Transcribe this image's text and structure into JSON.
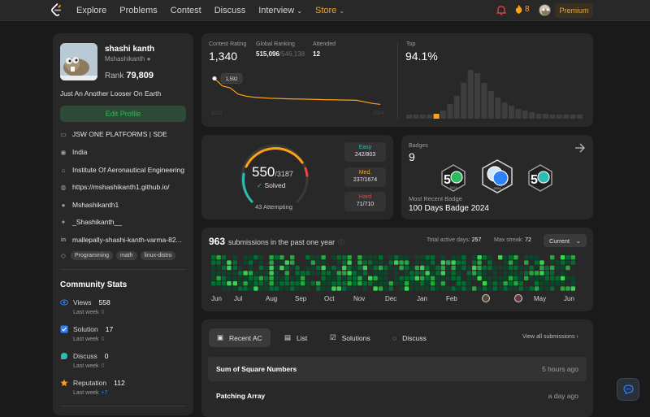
{
  "nav": {
    "links": [
      "Explore",
      "Problems",
      "Contest",
      "Discuss",
      "Interview",
      "Store"
    ],
    "streak": "8",
    "premium": "Premium"
  },
  "profile": {
    "name": "shashi kanth",
    "handle": "Mshashikanth",
    "rank_label": "Rank",
    "rank": "79,809",
    "bio": "Just An Another Looser On Earth",
    "edit": "Edit Profile",
    "info": [
      {
        "icon": "briefcase-icon",
        "text": "JSW ONE PLATFORMS | SDE"
      },
      {
        "icon": "location-icon",
        "text": "India"
      },
      {
        "icon": "school-icon",
        "text": "Institute Of Aeronautical Engineering"
      },
      {
        "icon": "globe-icon",
        "text": "https://mshashikanth1.github.io/"
      },
      {
        "icon": "github-icon",
        "text": "Mshashikanth1"
      },
      {
        "icon": "twitter-icon",
        "text": "_Shashikanth__"
      },
      {
        "icon": "linkedin-icon",
        "text": "mallepally-shashi-kanth-varma-82..."
      }
    ],
    "tags": [
      "Programming",
      "math",
      "linux-distro"
    ]
  },
  "community": {
    "title": "Community Stats",
    "stats": [
      {
        "label": "Views",
        "value": "558",
        "sub": "Last week",
        "delta": "0",
        "color": "#2f81f7"
      },
      {
        "label": "Solution",
        "value": "17",
        "sub": "Last week",
        "delta": "0",
        "color": "#2f81f7"
      },
      {
        "label": "Discuss",
        "value": "0",
        "sub": "Last week",
        "delta": "0",
        "color": "#2cbbb3"
      },
      {
        "label": "Reputation",
        "value": "112",
        "sub": "Last week",
        "delta": "+7",
        "color": "#ffa116"
      }
    ]
  },
  "contest": {
    "rating_label": "Contest Rating",
    "rating": "1,340",
    "global_label": "Global Ranking",
    "global": "515,096",
    "global_total": "/546,138",
    "attended_label": "Attended",
    "attended": "12",
    "tooltip": "1,592",
    "year_start": "2023",
    "year_end": "2024",
    "top_label": "Top",
    "top": "94.1%",
    "histogram": [
      2,
      2,
      2,
      2,
      3,
      5,
      9,
      14,
      22,
      30,
      28,
      22,
      17,
      13,
      10,
      8,
      6,
      5,
      4,
      3,
      3,
      2,
      2,
      2,
      2,
      2
    ],
    "highlight_index": 4,
    "line": [
      1592,
      1520,
      1500,
      1440,
      1420,
      1410,
      1405,
      1400,
      1398,
      1395,
      1393,
      1392,
      1390,
      1388,
      1386,
      1385,
      1383,
      1382,
      1380,
      1365,
      1350,
      1340
    ]
  },
  "solved": {
    "solved": "550",
    "total": "/3187",
    "label": "Solved",
    "attempting": "43 Attempting",
    "easy_label": "Easy",
    "easy": "242/803",
    "med_label": "Med.",
    "med": "237/1674",
    "hard_label": "Hard",
    "hard": "71/710",
    "colors": {
      "easy": "#2cbbb3",
      "med": "#ffa116",
      "hard": "#ef4743"
    }
  },
  "badges": {
    "label": "Badges",
    "count": "9",
    "recent_label": "Most Recent Badge",
    "recent": "100 Days Badge 2024",
    "badge_years": [
      "2023",
      "2024",
      ""
    ]
  },
  "submissions": {
    "count": "963",
    "label": "submissions in the past one year",
    "active_label": "Total active days:",
    "active": "257",
    "streak_label": "Max streak:",
    "streak": "72",
    "current": "Current",
    "months": [
      "Jun",
      "Jul",
      "Aug",
      "Sep",
      "Oct",
      "Nov",
      "Dec",
      "Jan",
      "Feb",
      "",
      "",
      "May",
      "Jun"
    ]
  },
  "list": {
    "tabs": [
      "Recent AC",
      "List",
      "Solutions",
      "Discuss"
    ],
    "view_all": "View all submissions",
    "rows": [
      {
        "title": "Sum of Square Numbers",
        "time": "5 hours ago"
      },
      {
        "title": "Patching Array",
        "time": "a day ago"
      }
    ]
  }
}
